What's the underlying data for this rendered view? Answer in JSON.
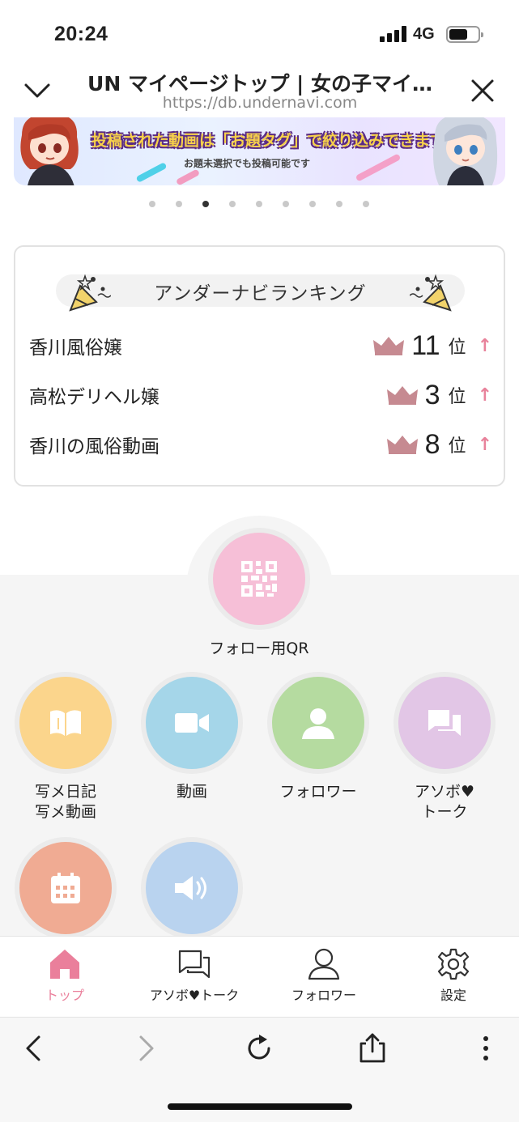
{
  "status_bar": {
    "time": "20:24",
    "network": "4G"
  },
  "browser_header": {
    "title": "UN マイページトップ | 女の子マイ…",
    "url": "https://db.undernavi.com"
  },
  "banner": {
    "headline": "投稿された動画は「お題タグ」で絞り込みできます!",
    "subtext": "お題未選択でも投稿可能です",
    "slide_count": 9,
    "active_slide_index": 2
  },
  "ranking": {
    "title": "アンダーナビランキング",
    "rank_unit": "位",
    "items": [
      {
        "name": "香川風俗嬢",
        "rank": "11",
        "trend": "↑"
      },
      {
        "name": "高松デリヘル嬢",
        "rank": "3",
        "trend": "↑"
      },
      {
        "name": "香川の風俗動画",
        "rank": "8",
        "trend": "↑"
      }
    ]
  },
  "menu": {
    "qr": {
      "label": "フォロー用QR",
      "icon": "qr-code-icon",
      "color": "#f6bfd7"
    },
    "items": [
      {
        "label_line1": "写メ日記",
        "label_line2": "写メ動画",
        "icon": "book-icon",
        "color": "#fbd58c"
      },
      {
        "label_line1": "動画",
        "label_line2": "",
        "icon": "video-camera-icon",
        "color": "#a5d6e9"
      },
      {
        "label_line1": "フォロワー",
        "label_line2": "",
        "icon": "person-icon",
        "color": "#b5dba0"
      },
      {
        "label_line1": "アソボ♥",
        "label_line2": "トーク",
        "icon": "chat-icon",
        "color": "#e2c6e6"
      },
      {
        "label_line1": "",
        "label_line2": "",
        "icon": "calendar-icon",
        "color": "#f0ab93"
      },
      {
        "label_line1": "",
        "label_line2": "",
        "icon": "speaker-icon",
        "color": "#b9d3ef"
      }
    ]
  },
  "tab_bar": {
    "active_color": "#ea7f9b",
    "tabs": [
      {
        "label": "トップ",
        "icon": "home-icon",
        "active": true
      },
      {
        "label": "アソボ♥トーク",
        "icon": "chat-icon",
        "active": false
      },
      {
        "label": "フォロワー",
        "icon": "person-icon",
        "active": false
      },
      {
        "label": "設定",
        "icon": "gear-icon",
        "active": false
      }
    ]
  },
  "browser_toolbar": {
    "buttons": [
      "back-icon",
      "forward-icon",
      "reload-icon",
      "share-icon",
      "more-icon"
    ]
  }
}
